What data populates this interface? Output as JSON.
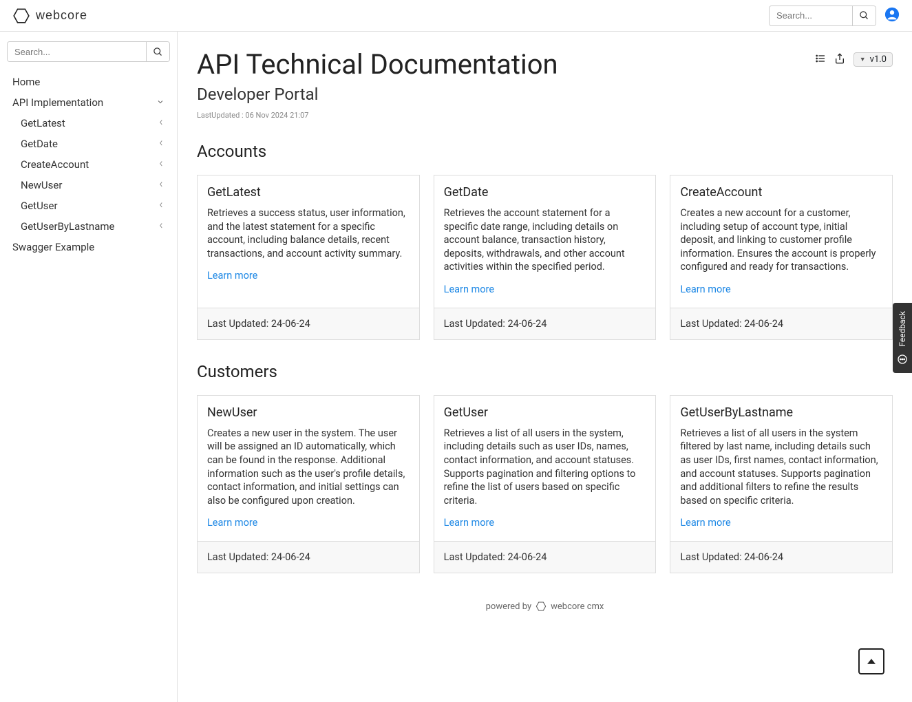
{
  "brand": {
    "name": "webcore"
  },
  "header": {
    "search_placeholder": "Search..."
  },
  "sidebar": {
    "search_placeholder": "Search...",
    "items": [
      {
        "label": "Home",
        "expandable": false
      },
      {
        "label": "API Implementation",
        "expandable": true,
        "open": true,
        "children": [
          {
            "label": "GetLatest"
          },
          {
            "label": "GetDate"
          },
          {
            "label": "CreateAccount"
          },
          {
            "label": "NewUser"
          },
          {
            "label": "GetUser"
          },
          {
            "label": "GetUserByLastname"
          }
        ]
      },
      {
        "label": "Swagger Example",
        "expandable": false
      }
    ]
  },
  "page": {
    "title": "API Technical Documentation",
    "subtitle": "Developer Portal",
    "last_updated": "LastUpdated : 06 Nov 2024 21:07",
    "version": "v1.0"
  },
  "sections": [
    {
      "title": "Accounts",
      "cards": [
        {
          "title": "GetLatest",
          "desc": "Retrieves a success status, user information, and the latest statement for a specific account, including balance details, recent transactions, and account activity summary.",
          "learn_more": "Learn more",
          "footer": "Last Updated: 24-06-24"
        },
        {
          "title": "GetDate",
          "desc": "Retrieves the account statement for a specific date range, including details on account balance, transaction history, deposits, withdrawals, and other account activities within the specified period.",
          "learn_more": "Learn more",
          "footer": "Last Updated: 24-06-24"
        },
        {
          "title": "CreateAccount",
          "desc": "Creates a new account for a customer, including setup of account type, initial deposit, and linking to customer profile information. Ensures the account is properly configured and ready for transactions.",
          "learn_more": "Learn more",
          "footer": "Last Updated: 24-06-24"
        }
      ]
    },
    {
      "title": "Customers",
      "cards": [
        {
          "title": "NewUser",
          "desc": "Creates a new user in the system. The user will be assigned an ID automatically, which can be found in the response. Additional information such as the user's profile details, contact information, and initial settings can also be configured upon creation.",
          "learn_more": "Learn more",
          "footer": "Last Updated: 24-06-24"
        },
        {
          "title": "GetUser",
          "desc": "Retrieves a list of all users in the system, including details such as user IDs, names, contact information, and account statuses. Supports pagination and filtering options to refine the list of users based on specific criteria.",
          "learn_more": "Learn more",
          "footer": "Last Updated: 24-06-24"
        },
        {
          "title": "GetUserByLastname",
          "desc": "Retrieves a list of all users in the system filtered by last name, including details such as user IDs, first names, contact information, and account statuses. Supports pagination and additional filters to refine the results based on specific criteria.",
          "learn_more": "Learn more",
          "footer": "Last Updated: 24-06-24"
        }
      ]
    }
  ],
  "footer": {
    "prefix": "powered by",
    "brand": "webcore cmx"
  },
  "feedback": {
    "label": "Feedback"
  }
}
